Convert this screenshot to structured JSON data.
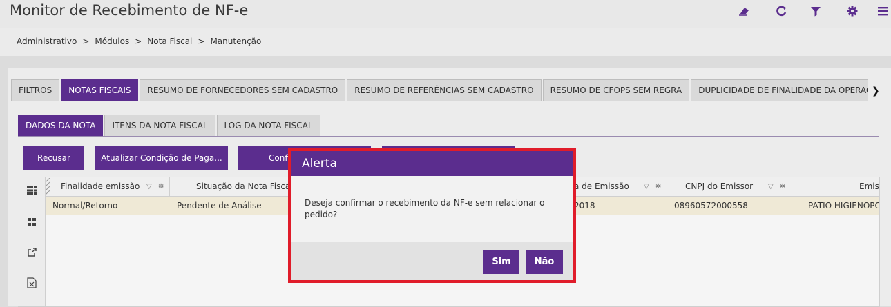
{
  "header": {
    "title": "Monitor de Recebimento de NF-e",
    "icons": [
      "eraser-icon",
      "refresh-icon",
      "filter-icon",
      "gear-icon",
      "menu-icon"
    ]
  },
  "breadcrumb": [
    "Administrativo",
    "Módulos",
    "Nota Fiscal",
    "Manutenção"
  ],
  "breadcrumb_sep": ">",
  "main_tabs": [
    {
      "label": "FILTROS",
      "active": false
    },
    {
      "label": "NOTAS FISCAIS",
      "active": true
    },
    {
      "label": "RESUMO DE FORNECEDORES SEM CADASTRO",
      "active": false
    },
    {
      "label": "RESUMO DE REFERÊNCIAS SEM CADASTRO",
      "active": false
    },
    {
      "label": "RESUMO DE CFOPS SEM REGRA",
      "active": false
    },
    {
      "label": "DUPLICIDADE DE FINALIDADE DA OPERAÇÃO",
      "active": false
    }
  ],
  "sub_tabs": [
    {
      "label": "DADOS DA NOTA",
      "active": true
    },
    {
      "label": "ITENS DA NOTA FISCAL",
      "active": false
    },
    {
      "label": "LOG DA NOTA FISCAL",
      "active": false
    }
  ],
  "actions": {
    "recusar": "Recusar",
    "atualizar": "Atualizar Condição de Paga...",
    "confirmar": "Confi"
  },
  "grid": {
    "columns": [
      "Finalidade emissão",
      "Situação da Nota Fiscal",
      "a de Emissão",
      "CNPJ do Emissor",
      "Emis"
    ],
    "row": [
      "Normal/Retorno",
      "Pendente de Análise",
      "2018",
      "08960572000558",
      "PATIO HIGIENOPO"
    ]
  },
  "dialog": {
    "title": "Alerta",
    "message": "Deseja confirmar o recebimento da NF-e sem relacionar o pedido?",
    "yes": "Sim",
    "no": "Não"
  },
  "colors": {
    "accent": "#5b2d8e",
    "highlight": "#e01c2a",
    "row_selected": "#efe9d6"
  }
}
